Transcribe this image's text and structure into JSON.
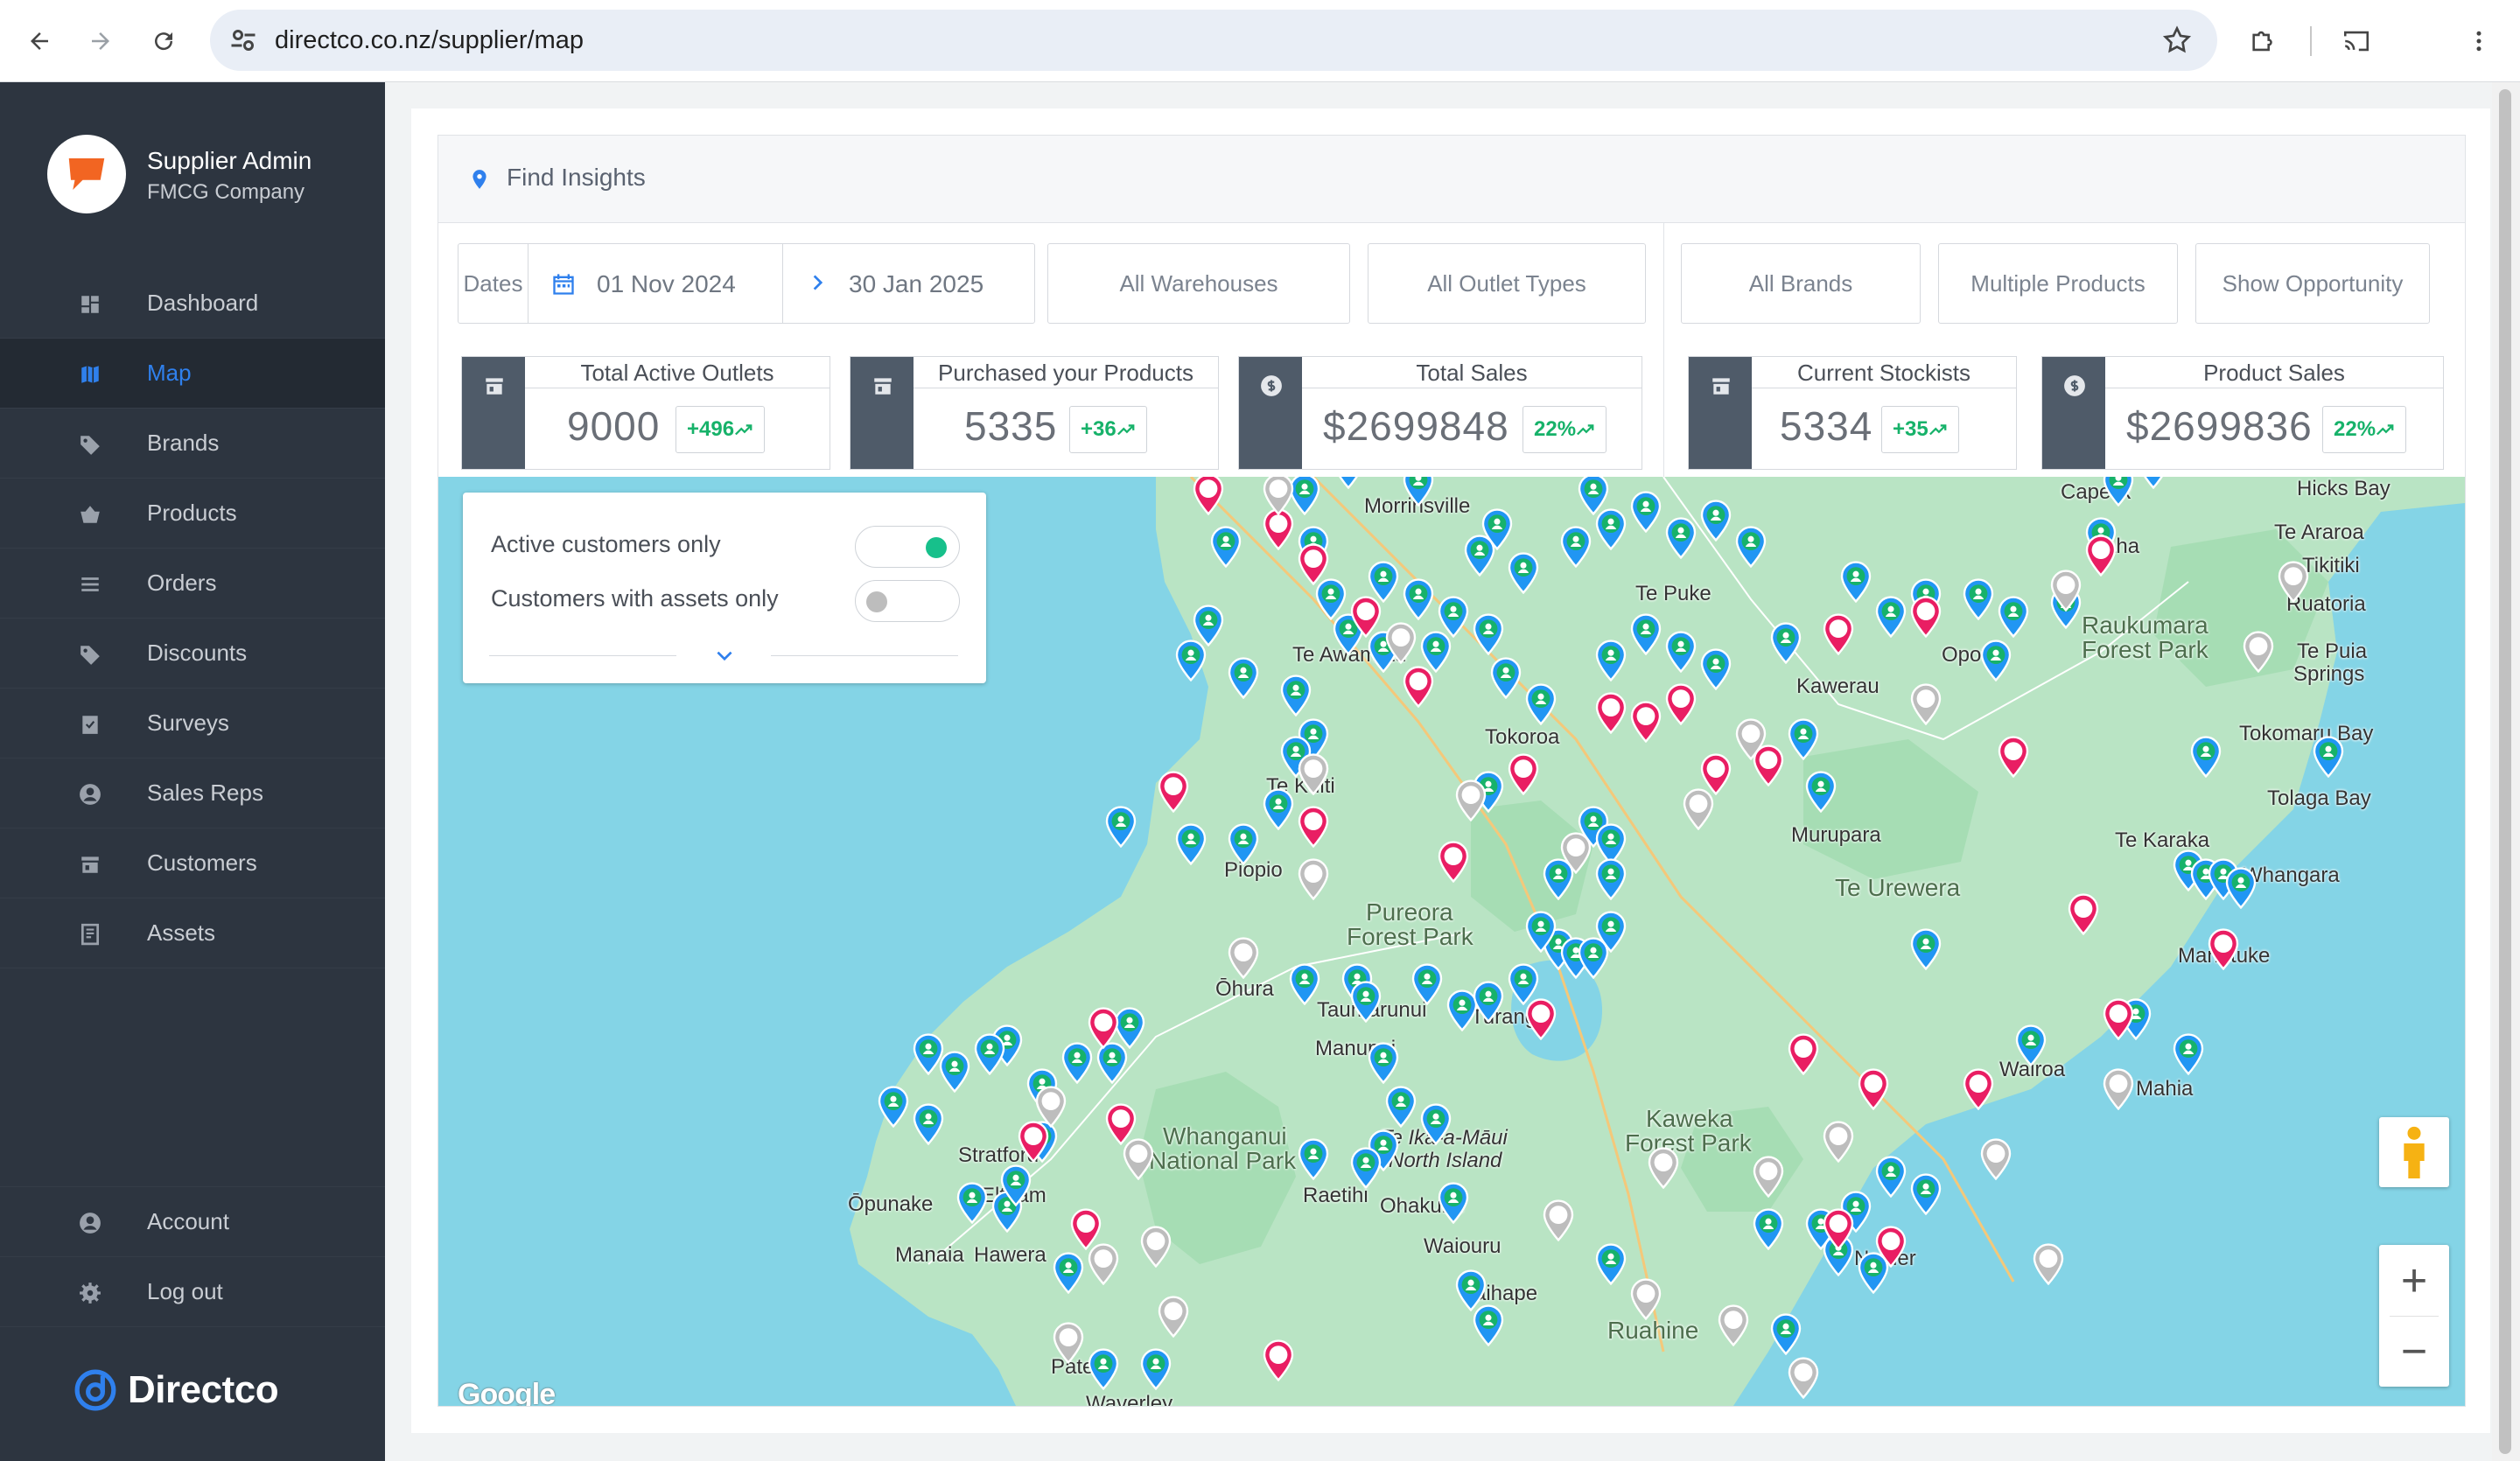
{
  "browser": {
    "url": "directco.co.nz/supplier/map",
    "back_icon": "arrow-left-icon",
    "forward_icon": "arrow-right-icon",
    "reload_icon": "reload-icon",
    "bookmark_icon": "star-icon",
    "extensions_icon": "puzzle-icon",
    "cast_icon": "cast-icon",
    "menu_icon": "kebab-menu-icon"
  },
  "sidebar": {
    "user_name": "Supplier Admin",
    "company": "FMCG Company",
    "items": [
      {
        "label": "Dashboard",
        "icon": "dashboard-icon",
        "active": false
      },
      {
        "label": "Map",
        "icon": "map-icon",
        "active": true
      },
      {
        "label": "Brands",
        "icon": "tag-icon",
        "active": false
      },
      {
        "label": "Products",
        "icon": "basket-icon",
        "active": false
      },
      {
        "label": "Orders",
        "icon": "list-icon",
        "active": false
      },
      {
        "label": "Discounts",
        "icon": "tag-icon",
        "active": false
      },
      {
        "label": "Surveys",
        "icon": "clipboard-check-icon",
        "active": false
      },
      {
        "label": "Sales Reps",
        "icon": "user-circle-icon",
        "active": false
      },
      {
        "label": "Customers",
        "icon": "store-icon",
        "active": false
      },
      {
        "label": "Assets",
        "icon": "document-icon",
        "active": false
      }
    ],
    "bottom_items": [
      {
        "label": "Account",
        "icon": "user-circle-icon"
      },
      {
        "label": "Log out",
        "icon": "gear-icon"
      }
    ],
    "logo_text": "Directco"
  },
  "panel": {
    "title": "Find Insights"
  },
  "filters": {
    "dates_label": "Dates",
    "date_from": "01 Nov 2024",
    "date_to": "30 Jan 2025",
    "warehouses": "All Warehouses",
    "outlet_types": "All Outlet Types",
    "brands": "All Brands",
    "products": "Multiple Products",
    "opportunity": "Show Opportunity"
  },
  "stats": [
    {
      "label": "Total Active Outlets",
      "value": "9000",
      "change": "+496",
      "icon": "store-icon"
    },
    {
      "label": "Purchased your Products",
      "value": "5335",
      "change": "+36",
      "icon": "store-icon"
    },
    {
      "label": "Total Sales",
      "value": "$2699848",
      "change": "22%",
      "icon": "dollar-icon"
    },
    {
      "label": "Current Stockists",
      "value": "5334",
      "change": "+35",
      "icon": "store-icon"
    },
    {
      "label": "Product Sales",
      "value": "$2699836",
      "change": "22%",
      "icon": "dollar-icon"
    }
  ],
  "map": {
    "toggles": [
      {
        "label": "Active customers only",
        "on": true
      },
      {
        "label": "Customers with assets only",
        "on": false
      }
    ],
    "labels": [
      "Morrinsville",
      "Te Puke",
      "Cape R",
      "aha",
      "Hicks Bay",
      "Te Araroa",
      "Tikitiki",
      "Ruatoria",
      "Raukumara",
      "Forest Park",
      "Te Puia",
      "Springs",
      "Tokomaru Bay",
      "Tolaga Bay",
      "Te Karaka",
      "Whangara",
      "Manutuke",
      "Te Awamutu",
      "Kawerau",
      "Opotiki",
      "Tokoroa",
      "Te Kuiti",
      "Murupara",
      "Te Urewera",
      "Piopio",
      "Pureora",
      "Forest Park",
      "Ōhura",
      "Taumarunui",
      "Turangi",
      "Manunui",
      "Whanganui",
      "National Park",
      "Te Ika-a-Māui",
      "North Island",
      "Kaweka",
      "Forest Park",
      "Raetihi",
      "Ohakune",
      "Waiouru",
      "Taihape",
      "Ruahine",
      "Ōpunake",
      "Manaia",
      "Hawera",
      "Stratford",
      "Eltham",
      "Patea",
      "Waverley",
      "Wairoa",
      "Mahia",
      "Napier"
    ],
    "colors": {
      "water": "#84d4e6",
      "land": "#b9e4c4",
      "customer": "#2196f3",
      "active": "#17b26a",
      "opportunity": "#e91e63",
      "inactive": "#bdbdbd"
    },
    "zoom_in": "+",
    "zoom_out": "−",
    "pegman_icon": "pegman-icon",
    "attribution": "Google"
  }
}
